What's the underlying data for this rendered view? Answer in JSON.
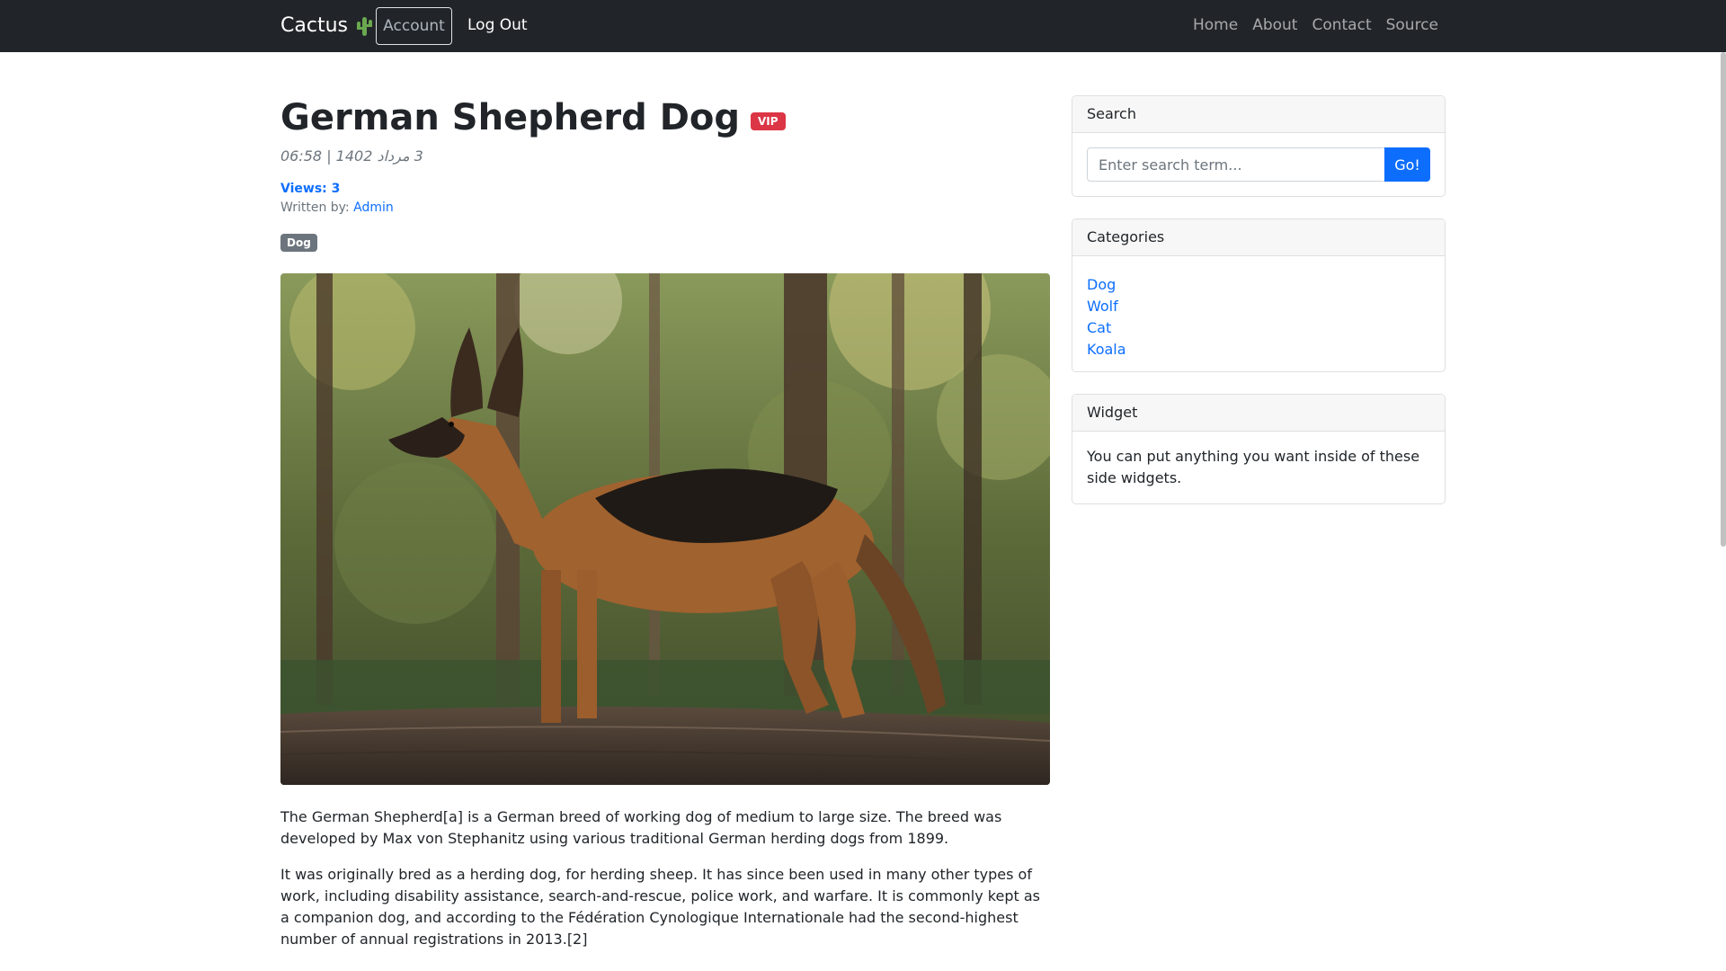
{
  "navbar": {
    "brand": "Cactus",
    "brand_icon": "cactus-icon",
    "account_label": "Account",
    "logout_label": "Log Out",
    "links": [
      "Home",
      "About",
      "Contact",
      "Source"
    ]
  },
  "post": {
    "title": "German Shepherd Dog",
    "badge": "VIP",
    "date": "3 مرداد 1402 | 06:58",
    "views": "Views: 3",
    "written_by_label": "Written by: ",
    "author": "Admin",
    "tag": "Dog",
    "paragraphs": [
      "The German Shepherd[a] is a German breed of working dog of medium to large size. The breed was developed by Max von Stephanitz using various traditional German herding dogs from 1899.",
      "It was originally bred as a herding dog, for herding sheep. It has since been used in many other types of work, including disability assistance, search-and-rescue, police work, and warfare. It is commonly kept as a companion dog, and according to the Fédération Cynologique Internationale had the second-highest number of annual registrations in 2013.[2]"
    ]
  },
  "sidebar": {
    "search": {
      "title": "Search",
      "placeholder": "Enter search term...",
      "button": "Go!"
    },
    "categories": {
      "title": "Categories",
      "items": [
        "Dog",
        "Wolf",
        "Cat",
        "Koala"
      ]
    },
    "widget": {
      "title": "Widget",
      "text": "You can put anything you want inside of these side widgets."
    }
  },
  "colors": {
    "navbar_bg": "#212529",
    "link": "#0d6efd",
    "vip_badge": "#dc3545",
    "tag_badge": "#6c757d",
    "go_button": "#0d6efd"
  }
}
